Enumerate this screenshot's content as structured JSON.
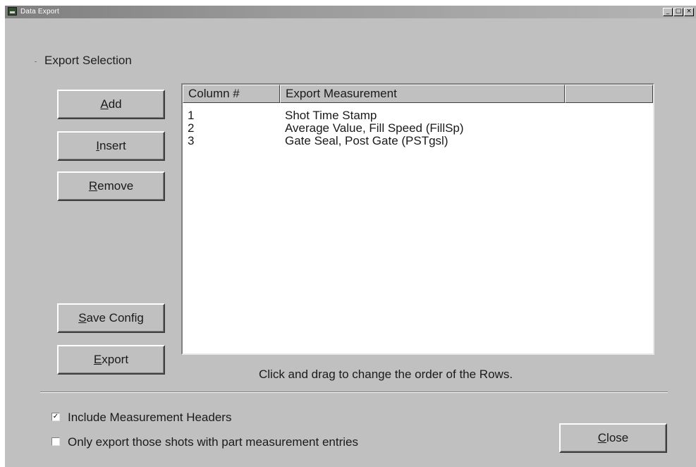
{
  "window": {
    "title": "Data Export",
    "minimize_glyph": "_",
    "maximize_glyph": "□",
    "close_glyph": "×"
  },
  "export_selection": {
    "group_label": "Export Selection",
    "buttons": {
      "add": {
        "accel": "A",
        "rest": "dd"
      },
      "insert": {
        "accel": "I",
        "rest": "nsert"
      },
      "remove": {
        "accel": "R",
        "rest": "emove"
      },
      "save_config": {
        "accel": "S",
        "rest": "ave Config"
      },
      "export": {
        "accel": "E",
        "rest": "xport"
      }
    },
    "list": {
      "columns": [
        "Column #",
        "Export Measurement",
        ""
      ],
      "rows": [
        {
          "column_no": "1",
          "measurement": "Shot Time Stamp"
        },
        {
          "column_no": "2",
          "measurement": "Average Value, Fill Speed (FillSp)"
        },
        {
          "column_no": "3",
          "measurement": "Gate Seal, Post Gate (PSTgsl)"
        }
      ]
    },
    "hint": "Click and drag to change the order of the Rows."
  },
  "options": {
    "include_headers": {
      "label": "Include Measurement Headers",
      "checked": true,
      "check_glyph": "✓"
    },
    "only_part_entries": {
      "label": "Only export those shots with part measurement entries",
      "checked": false
    }
  },
  "close_button": {
    "accel": "C",
    "rest": "lose"
  }
}
